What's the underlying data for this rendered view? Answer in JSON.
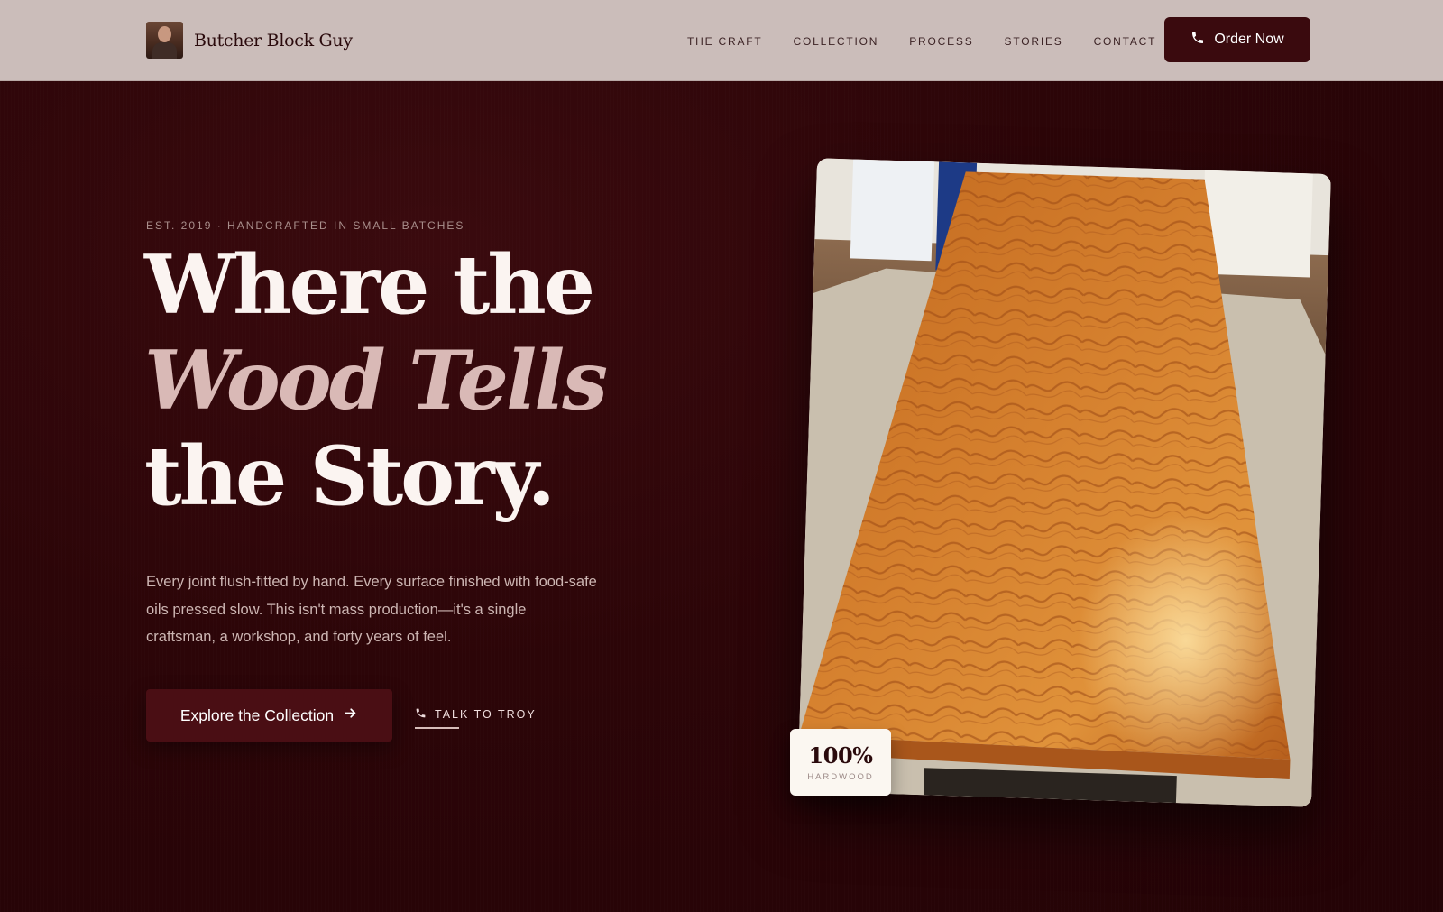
{
  "nav": {
    "brand_name": "Butcher Block Guy",
    "links": [
      "THE CRAFT",
      "COLLECTION",
      "PROCESS",
      "STORIES",
      "CONTACT"
    ],
    "order_button": "Order Now"
  },
  "hero": {
    "eyebrow": "EST. 2019 · HANDCRAFTED IN SMALL BATCHES",
    "headline_line1": "Where the",
    "headline_line2": "Wood Tells",
    "headline_line3": "the Story.",
    "body": "Every joint flush-fitted by hand. Every surface finished with food-safe oils pressed slow. This isn't mass production—it's a single craftsman, a workshop, and forty years of feel.",
    "cta_label": "Explore the Collection",
    "secondary_label": "TALK TO TROY"
  },
  "stat": {
    "value": "100%",
    "label": "HARDWOOD"
  },
  "colors": {
    "nav_bg": "#cbbdba",
    "hero_bg": "#2a0407",
    "accent": "#3a0a0e",
    "italic_text": "#d9b9b6"
  }
}
